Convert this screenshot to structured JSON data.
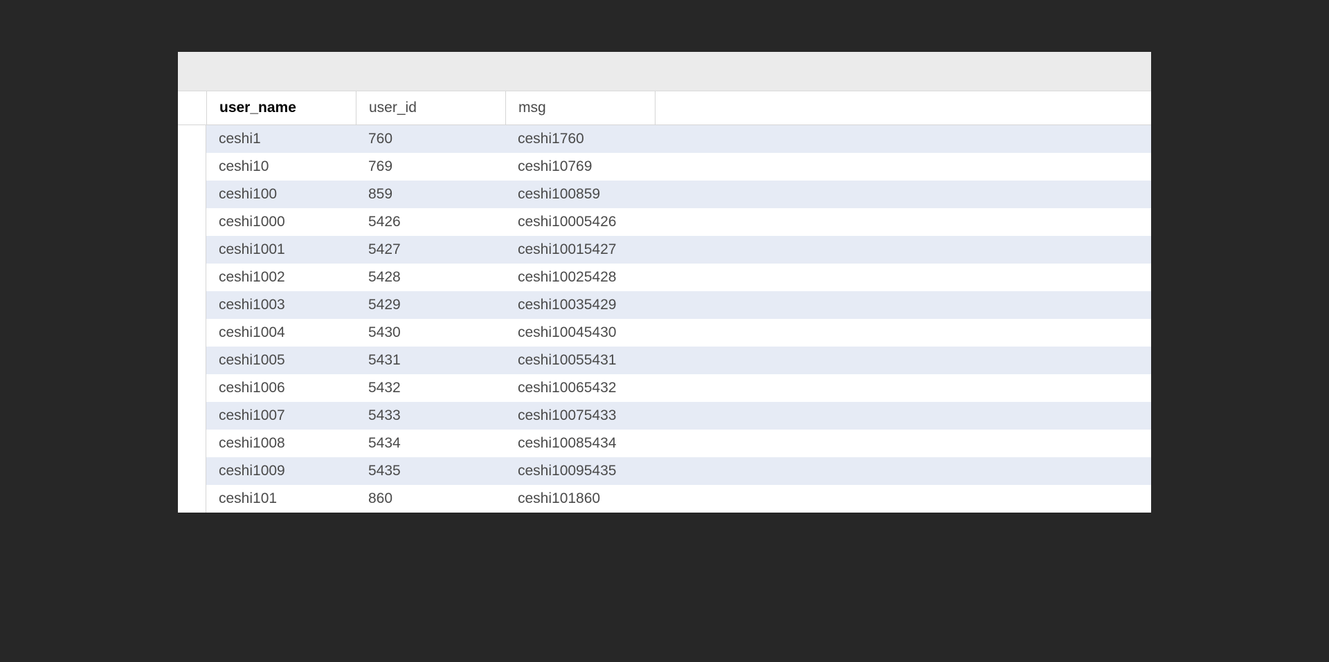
{
  "columns": {
    "user_name": "user_name",
    "user_id": "user_id",
    "msg": "msg"
  },
  "rows": [
    {
      "user_name": "ceshi1",
      "user_id": "760",
      "msg": "ceshi1760"
    },
    {
      "user_name": "ceshi10",
      "user_id": "769",
      "msg": "ceshi10769"
    },
    {
      "user_name": "ceshi100",
      "user_id": "859",
      "msg": "ceshi100859"
    },
    {
      "user_name": "ceshi1000",
      "user_id": "5426",
      "msg": "ceshi10005426"
    },
    {
      "user_name": "ceshi1001",
      "user_id": "5427",
      "msg": "ceshi10015427"
    },
    {
      "user_name": "ceshi1002",
      "user_id": "5428",
      "msg": "ceshi10025428"
    },
    {
      "user_name": "ceshi1003",
      "user_id": "5429",
      "msg": "ceshi10035429"
    },
    {
      "user_name": "ceshi1004",
      "user_id": "5430",
      "msg": "ceshi10045430"
    },
    {
      "user_name": "ceshi1005",
      "user_id": "5431",
      "msg": "ceshi10055431"
    },
    {
      "user_name": "ceshi1006",
      "user_id": "5432",
      "msg": "ceshi10065432"
    },
    {
      "user_name": "ceshi1007",
      "user_id": "5433",
      "msg": "ceshi10075433"
    },
    {
      "user_name": "ceshi1008",
      "user_id": "5434",
      "msg": "ceshi10085434"
    },
    {
      "user_name": "ceshi1009",
      "user_id": "5435",
      "msg": "ceshi10095435"
    },
    {
      "user_name": "ceshi101",
      "user_id": "860",
      "msg": "ceshi101860"
    }
  ]
}
